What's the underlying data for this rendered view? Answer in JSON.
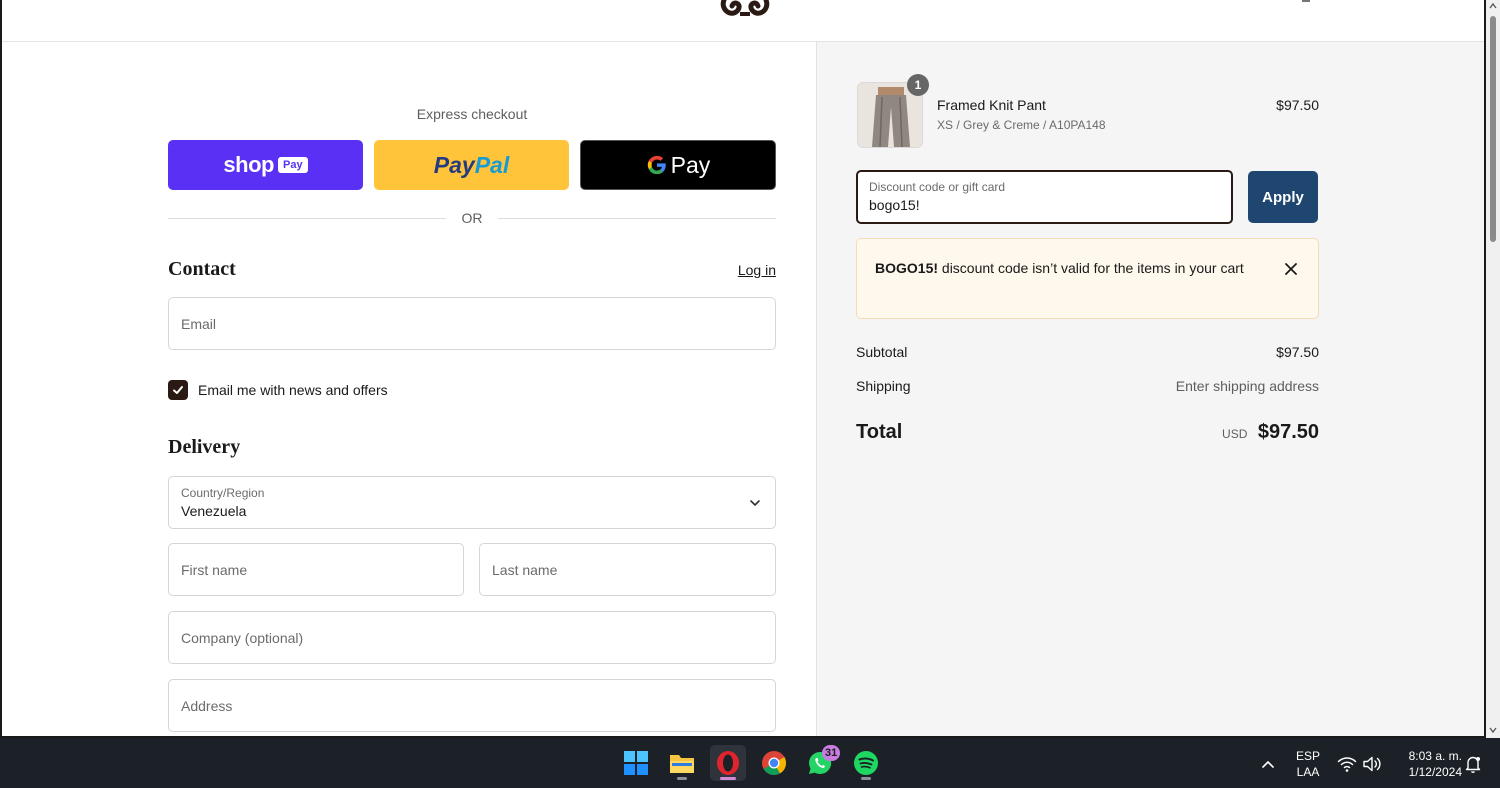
{
  "express": {
    "label": "Express checkout",
    "shop_word": "shop",
    "shop_pay": "Pay",
    "paypal_1": "Pay",
    "paypal_2": "Pal",
    "gpay_word": "Pay",
    "or": "OR"
  },
  "contact": {
    "title": "Contact",
    "login": "Log in",
    "email_placeholder": "Email",
    "newsletter_label": "Email me with news and offers",
    "newsletter_checked": true
  },
  "delivery": {
    "title": "Delivery",
    "country_label": "Country/Region",
    "country_value": "Venezuela",
    "first_name_placeholder": "First name",
    "last_name_placeholder": "Last name",
    "company_placeholder": "Company (optional)",
    "address_placeholder": "Address"
  },
  "summary": {
    "product": {
      "quantity": "1",
      "name": "Framed Knit Pant",
      "variant": "XS / Grey & Creme / A10PA148",
      "price": "$97.50"
    },
    "discount": {
      "label": "Discount code or gift card",
      "value": "bogo15!",
      "apply": "Apply"
    },
    "alert": {
      "code": "BOGO15!",
      "message": " discount code isn’t valid for the items in your cart"
    },
    "subtotal_label": "Subtotal",
    "subtotal_value": "$97.50",
    "shipping_label": "Shipping",
    "shipping_value": "Enter shipping address",
    "total_label": "Total",
    "total_currency": "USD",
    "total_value": "$97.50"
  },
  "taskbar": {
    "whatsapp_badge": "31",
    "lang_1": "ESP",
    "lang_2": "LAA",
    "time": "8:03 a. m.",
    "date": "1/12/2024"
  },
  "colors": {
    "shop_pay": "#5a31f4",
    "paypal": "#ffc439",
    "apply": "#1f4571",
    "accent_dark": "#2b1a14",
    "alert_bg": "#fff8ec"
  }
}
